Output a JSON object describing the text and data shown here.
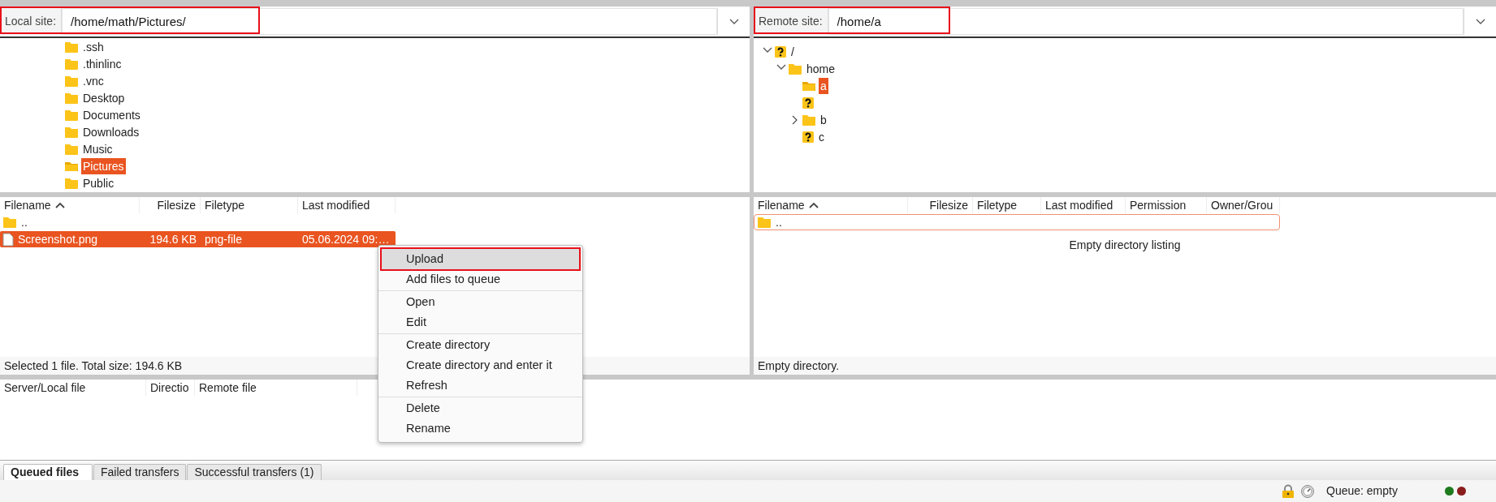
{
  "local_site": {
    "label": "Local site:",
    "path": "/home/math/Pictures/",
    "highlighted": true
  },
  "remote_site": {
    "label": "Remote site:",
    "path": "/home/a",
    "highlighted": true
  },
  "local_tree": [
    {
      "label": ".ssh",
      "kind": "folder",
      "selected": false
    },
    {
      "label": ".thinlinc",
      "kind": "folder",
      "selected": false
    },
    {
      "label": ".vnc",
      "kind": "folder",
      "selected": false
    },
    {
      "label": "Desktop",
      "kind": "folder",
      "selected": false
    },
    {
      "label": "Documents",
      "kind": "folder",
      "selected": false
    },
    {
      "label": "Downloads",
      "kind": "folder",
      "selected": false
    },
    {
      "label": "Music",
      "kind": "folder",
      "selected": false
    },
    {
      "label": "Pictures",
      "kind": "folder",
      "selected": true
    },
    {
      "label": "Public",
      "kind": "folder",
      "selected": false
    }
  ],
  "remote_tree": [
    {
      "label": "/",
      "kind": "unknown",
      "expanded": true,
      "selected": false,
      "children": [
        {
          "label": "home",
          "kind": "folder",
          "expanded": true,
          "selected": false,
          "children": [
            {
              "label": "a",
              "kind": "folder",
              "selected": true
            },
            {
              "kind": "unknown",
              "selected": false
            },
            {
              "label": "b",
              "kind": "folder",
              "expanded": false,
              "selected": false
            },
            {
              "label": "c",
              "kind": "unknown",
              "selected": false
            }
          ]
        }
      ]
    }
  ],
  "local_files": {
    "columns": [
      {
        "label": "Filename",
        "sorted": true
      },
      {
        "label": "Filesize",
        "sorted": false
      },
      {
        "label": "Filetype",
        "sorted": false
      },
      {
        "label": "Last modified",
        "sorted": false
      }
    ],
    "rows": [
      {
        "kind": "folder",
        "name": "..",
        "selected": false,
        "focused": false
      },
      {
        "kind": "file",
        "name": "Screenshot.png",
        "size": "194.6 KB",
        "type": "png-file",
        "modified": "05.06.2024 09:…",
        "selected": true,
        "focused": false
      }
    ],
    "status": "Selected 1 file. Total size: 194.6 KB"
  },
  "remote_files": {
    "columns": [
      {
        "label": "Filename",
        "sorted": true
      },
      {
        "label": "Filesize",
        "sorted": false
      },
      {
        "label": "Filetype",
        "sorted": false
      },
      {
        "label": "Last modified",
        "sorted": false
      },
      {
        "label": "Permission",
        "sorted": false
      },
      {
        "label": "Owner/Grou",
        "sorted": false
      }
    ],
    "rows": [
      {
        "kind": "folder",
        "name": "..",
        "selected": false,
        "focused": true
      }
    ],
    "empty_message": "Empty directory listing",
    "status": "Empty directory."
  },
  "context_menu": {
    "sections": [
      [
        {
          "label": "Upload",
          "hovered": true,
          "highlighted": true
        },
        {
          "label": "Add files to queue",
          "hovered": false,
          "highlighted": false
        }
      ],
      [
        {
          "label": "Open",
          "hovered": false,
          "highlighted": false
        },
        {
          "label": "Edit",
          "hovered": false,
          "highlighted": false
        }
      ],
      [
        {
          "label": "Create directory",
          "hovered": false,
          "highlighted": false
        },
        {
          "label": "Create directory and enter it",
          "hovered": false,
          "highlighted": false
        },
        {
          "label": "Refresh",
          "hovered": false,
          "highlighted": false
        }
      ],
      [
        {
          "label": "Delete",
          "hovered": false,
          "highlighted": false
        },
        {
          "label": "Rename",
          "hovered": false,
          "highlighted": false
        }
      ]
    ]
  },
  "queue": {
    "columns": [
      "Server/Local file",
      "Directio",
      "Remote file"
    ]
  },
  "queue_tabs": [
    {
      "label": "Queued files",
      "selected": true
    },
    {
      "label": "Failed transfers",
      "selected": false
    },
    {
      "label": "Successful transfers (1)",
      "selected": false
    }
  ],
  "status_bar": {
    "queue": "Queue: empty",
    "lights": [
      {
        "color": "#1d7a1d"
      },
      {
        "color": "#8a1c1c"
      }
    ]
  }
}
